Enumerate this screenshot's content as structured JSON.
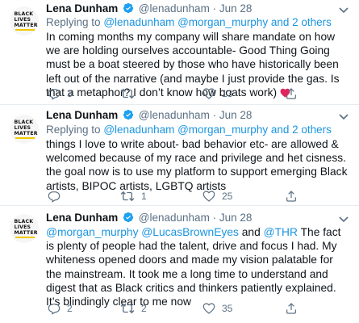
{
  "tweets": [
    {
      "avatar_text": [
        "BLACK",
        "LIVES",
        "MATTER"
      ],
      "name": "Lena Dunham",
      "handle": "@lenadunham",
      "dot": "·",
      "date": "Jun 28",
      "replying_prefix": "Replying to",
      "replying_mentions": "@lenadunham @morgan_murphy",
      "replying_suffix": "and 2 others",
      "body": "In coming months my company will share mandate on how we are holding ourselves accountable- Good Thing Going must be a boat steered by those who have historically been left out of the narrative (and maybe I just provide the gas. Is that a metaphor? I don’t know how boats work)",
      "body_emoji": "red-heart",
      "reply_count": "3",
      "retweet_count": "",
      "like_count": "13"
    },
    {
      "avatar_text": [
        "BLACK",
        "LIVES",
        "MATTER"
      ],
      "name": "Lena Dunham",
      "handle": "@lenadunham",
      "dot": "·",
      "date": "Jun 28",
      "replying_prefix": "Replying to",
      "replying_mentions": "@lenadunham @morgan_murphy",
      "replying_suffix": "and 2 others",
      "body": "things I love to write about- bad behavior etc- are allowed & welcomed because of my race and privilege and het cisness. the goal now is to use my platform to support emerging Black artists, BIPOC artists, LGBTQ artists",
      "reply_count": "",
      "retweet_count": "1",
      "like_count": "25"
    },
    {
      "avatar_text": [
        "BLACK",
        "LIVES",
        "MATTER"
      ],
      "name": "Lena Dunham",
      "handle": "@lenadunham",
      "dot": "·",
      "date": "Jun 28",
      "body_mentions": "@morgan_murphy @LucasBrownEyes",
      "body_and": "and",
      "body_mention_last": "@THR",
      "body": "The fact is plenty of people had the talent, drive and focus I had. My whiteness opened doors and made my vision palatable for the mainstream. It took me a long time to understand and digest that as Black critics and thinkers patiently explained. It’s blindingly clear to me now",
      "reply_count": "2",
      "retweet_count": "2",
      "like_count": "35"
    }
  ],
  "colors": {
    "text": "#0f1419",
    "secondary": "#5b7083",
    "link": "#1b95e0",
    "verified": "#1da1f2",
    "heart": "#e0245e",
    "divider": "#e6ecf0",
    "avatar_bar": "#f0c800"
  },
  "icons": {
    "reply": "reply-icon",
    "retweet": "retweet-icon",
    "like": "like-icon",
    "share": "share-icon",
    "verified": "verified-badge-icon",
    "more": "chevron-down-icon"
  }
}
